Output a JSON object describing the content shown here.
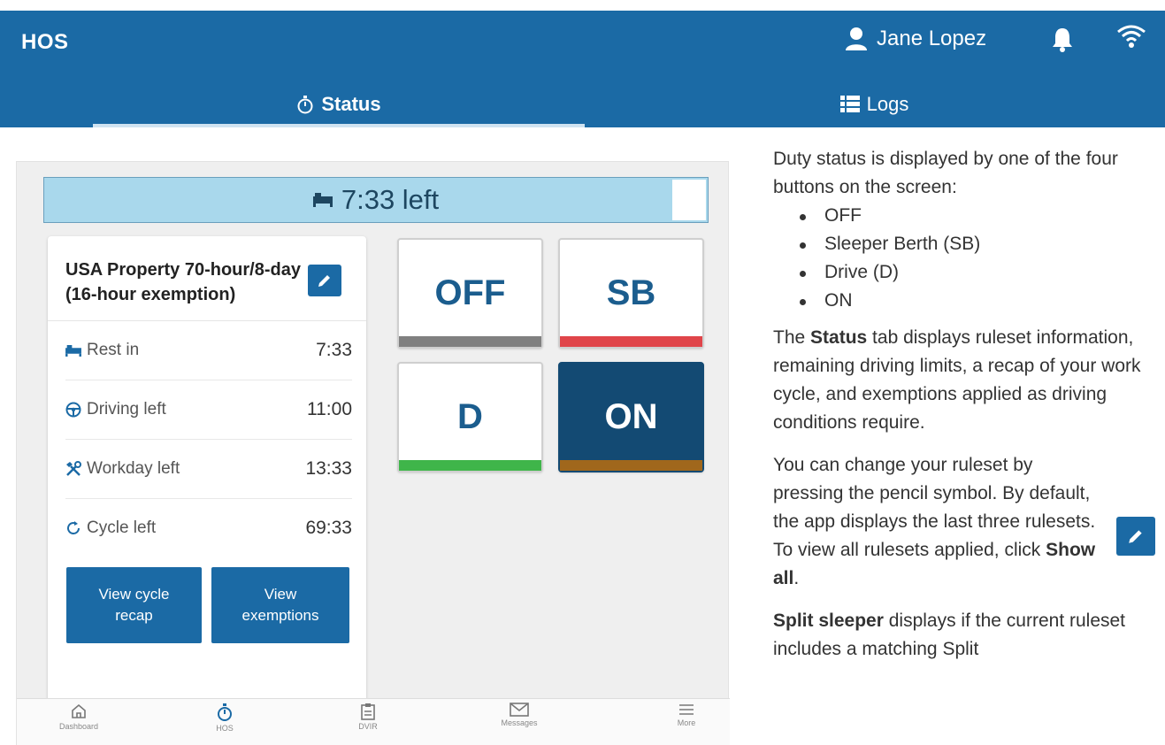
{
  "header": {
    "app_title": "HOS",
    "user_name": "Jane Lopez",
    "tabs": [
      {
        "label": "Status",
        "icon": "stopwatch-icon",
        "active": true
      },
      {
        "label": "Logs",
        "icon": "list-icon",
        "active": false
      }
    ]
  },
  "panel": {
    "time_left": "7:33 left",
    "ruleset": "USA Property 70-hour/8-day (16-hour exemption)",
    "rows": [
      {
        "label": "Rest in",
        "value": "7:33",
        "icon": "bed-icon"
      },
      {
        "label": "Driving left",
        "value": "11:00",
        "icon": "steering-wheel-icon"
      },
      {
        "label": "Workday left",
        "value": "13:33",
        "icon": "tools-icon"
      },
      {
        "label": "Cycle left",
        "value": "69:33",
        "icon": "cycle-icon"
      }
    ],
    "buttons": {
      "view_cycle_recap": "View cycle recap",
      "view_exemptions": "View exemptions"
    },
    "duty": {
      "off": "OFF",
      "sb": "SB",
      "d": "D",
      "on": "ON"
    },
    "duty_colors": {
      "off": "#808080",
      "sb": "#e0454a",
      "d": "#3fb54a",
      "on": "#a0671c"
    },
    "nav": [
      {
        "label": "Dashboard",
        "icon": "home-icon"
      },
      {
        "label": "HOS",
        "icon": "stopwatch-icon"
      },
      {
        "label": "DVIR",
        "icon": "clipboard-icon"
      },
      {
        "label": "Messages",
        "icon": "envelope-icon"
      },
      {
        "label": "More",
        "icon": "menu-icon"
      }
    ]
  },
  "doc": {
    "intro": "Duty status is displayed by one of the four buttons on the screen:",
    "bullets": [
      "OFF",
      "Sleeper Berth (SB)",
      "Drive (D)",
      "ON"
    ],
    "p1_a": "The ",
    "p1_b": "Status",
    "p1_c": " tab displays ruleset information, remaining driving limits, a recap of your work cycle, and exemptions applied as driving conditions require.",
    "p2_a": "You can change your ruleset by pressing the pencil symbol. By default, the app displays the last three rulesets. To view all rulesets applied, click ",
    "p2_b": "Show all",
    "p2_c": ".",
    "p3_a": "Split sleeper",
    "p3_b": " displays if the current ruleset includes a matching Split"
  },
  "colors": {
    "brand": "#1b6aa5",
    "timebar": "#a9d8ec"
  }
}
